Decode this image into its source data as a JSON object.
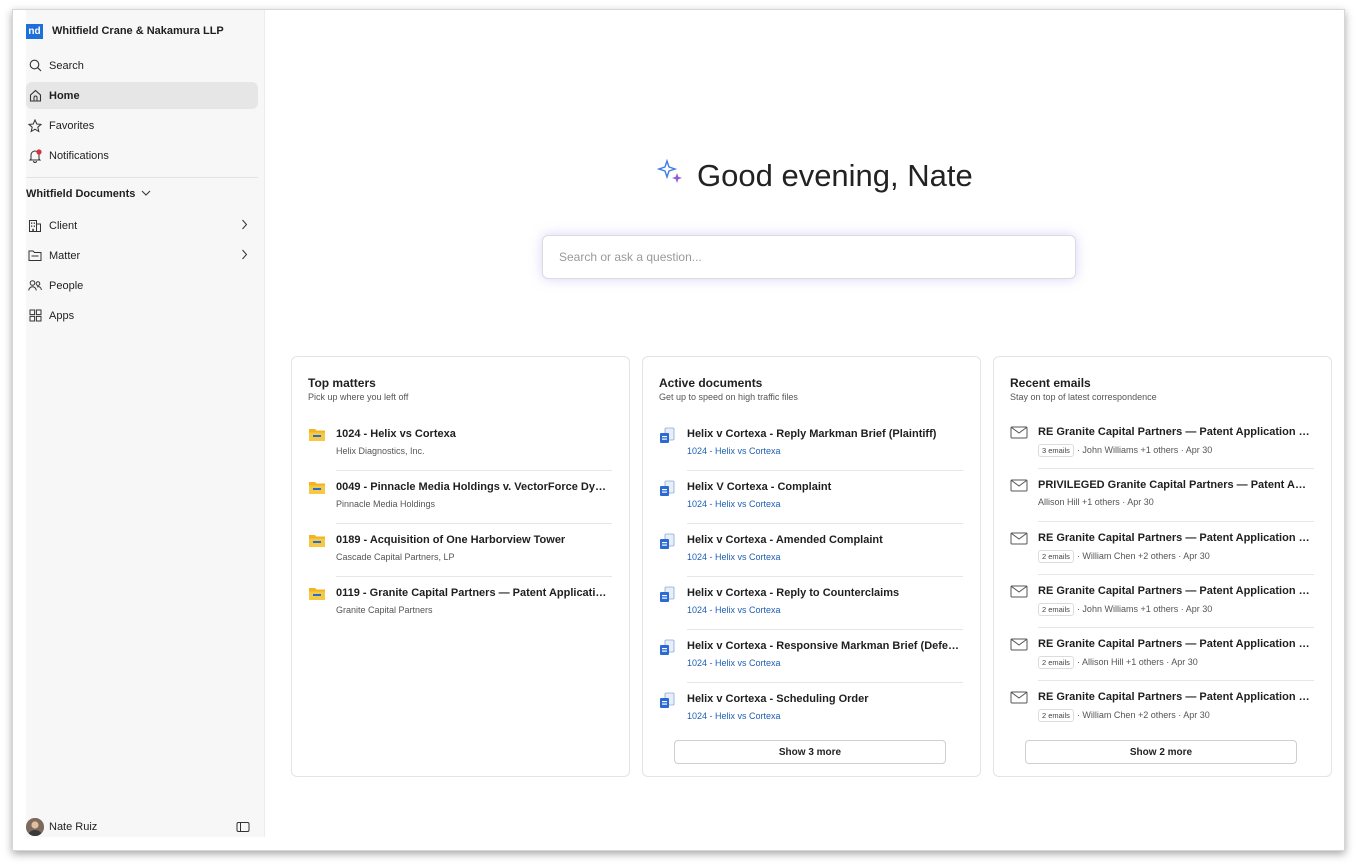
{
  "org": {
    "logo": "nd",
    "name": "Whitfield Crane & Nakamura LLP"
  },
  "nav": {
    "search": "Search",
    "home": "Home",
    "favorites": "Favorites",
    "notifications": "Notifications"
  },
  "documents_section": {
    "title": "Whitfield Documents",
    "items": {
      "client": "Client",
      "matter": "Matter",
      "people": "People",
      "apps": "Apps"
    }
  },
  "user": {
    "name": "Nate Ruiz"
  },
  "greeting": "Good evening, Nate",
  "search_box": {
    "placeholder": "Search or ask a question..."
  },
  "top_matters": {
    "title": "Top matters",
    "subtitle": "Pick up where you left off",
    "items": [
      {
        "title": "1024 - Helix vs Cortexa",
        "sub": "Helix Diagnostics, Inc."
      },
      {
        "title": "0049 - Pinnacle Media Holdings v. VectorForce Dyna...",
        "sub": "Pinnacle Media Holdings"
      },
      {
        "title": "0189 - Acquisition of One Harborview Tower",
        "sub": "Cascade Capital Partners, LP"
      },
      {
        "title": "0119 - Granite Capital Partners — Patent Application: ...",
        "sub": "Granite Capital Partners"
      }
    ]
  },
  "active_documents": {
    "title": "Active documents",
    "subtitle": "Get up to speed on high traffic files",
    "items": [
      {
        "title": "Helix v Cortexa - Reply Markman Brief (Plaintiff)",
        "sub": "1024 - Helix vs Cortexa"
      },
      {
        "title": "Helix V Cortexa - Complaint",
        "sub": "1024 - Helix vs Cortexa"
      },
      {
        "title": "Helix v Cortexa - Amended Complaint",
        "sub": "1024 - Helix vs Cortexa"
      },
      {
        "title": "Helix v Cortexa - Reply to Counterclaims",
        "sub": "1024 - Helix vs Cortexa"
      },
      {
        "title": "Helix v Cortexa - Responsive Markman Brief (Defenda...",
        "sub": "1024 - Helix vs Cortexa"
      },
      {
        "title": "Helix v Cortexa - Scheduling Order",
        "sub": "1024 - Helix vs Cortexa"
      }
    ],
    "more_label": "Show 3 more"
  },
  "recent_emails": {
    "title": "Recent emails",
    "subtitle": "Stay on top of latest correspondence",
    "items": [
      {
        "title": "RE Granite Capital Partners — Patent Application Mic...",
        "badge": "3 emails",
        "meta": "· John Williams +1 others · Apr 30"
      },
      {
        "title": "PRIVILEGED Granite Capital Partners — Patent Applic...",
        "badge": "",
        "meta": "Allison Hill +1 others · Apr 30"
      },
      {
        "title": "RE Granite Capital Partners — Patent Application Mic...",
        "badge": "2 emails",
        "meta": "· William Chen +2 others · Apr 30"
      },
      {
        "title": "RE Granite Capital Partners — Patent Application Mic...",
        "badge": "2 emails",
        "meta": "· John Williams +1 others · Apr 30"
      },
      {
        "title": "RE Granite Capital Partners — Patent Application Mic...",
        "badge": "2 emails",
        "meta": "· Allison Hill +1 others · Apr 30"
      },
      {
        "title": "RE Granite Capital Partners — Patent Application Mic...",
        "badge": "2 emails",
        "meta": "· William Chen +2 others · Apr 30"
      }
    ],
    "more_label": "Show 2 more"
  },
  "colors": {
    "accent": "#1e6fd9",
    "link": "#1f5fb3",
    "folder": "#f2b522",
    "notification_dot": "#d13438"
  }
}
